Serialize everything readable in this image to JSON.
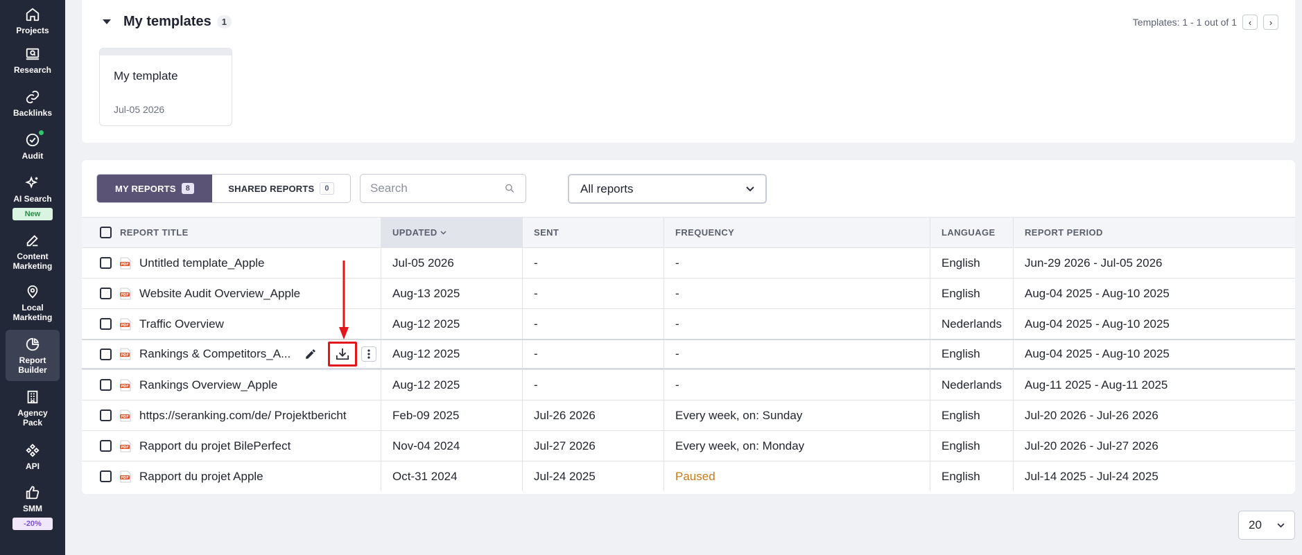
{
  "sidebar": {
    "items": [
      {
        "label": "Projects",
        "icon": "home-icon"
      },
      {
        "label": "Research",
        "icon": "research-icon"
      },
      {
        "label": "Backlinks",
        "icon": "link-icon"
      },
      {
        "label": "Audit",
        "icon": "check-circle-icon"
      },
      {
        "label": "AI Search",
        "icon": "sparkle-icon",
        "badge": "New"
      },
      {
        "label": "Content Marketing",
        "icon": "edit-icon"
      },
      {
        "label": "Local Marketing",
        "icon": "map-pin-icon"
      },
      {
        "label": "Report Builder",
        "icon": "pie-chart-icon",
        "active": true
      },
      {
        "label": "Agency Pack",
        "icon": "building-icon"
      },
      {
        "label": "API",
        "icon": "api-icon"
      },
      {
        "label": "SMM",
        "icon": "thumbs-up-icon",
        "badge": "-20%"
      }
    ]
  },
  "templates": {
    "title": "My templates",
    "count": "1",
    "pager_text": "Templates: 1 - 1 out of 1",
    "items": [
      {
        "name": "My template",
        "date": "Jul-05 2026"
      }
    ]
  },
  "reports": {
    "tabs": [
      {
        "label": "MY REPORTS",
        "count": "8"
      },
      {
        "label": "SHARED REPORTS",
        "count": "0"
      }
    ],
    "search_placeholder": "Search",
    "filter_value": "All reports",
    "columns": [
      "REPORT TITLE",
      "UPDATED",
      "SENT",
      "FREQUENCY",
      "LANGUAGE",
      "REPORT PERIOD"
    ],
    "rows": [
      {
        "title": "Untitled template_Apple",
        "updated": "Jul-05 2026",
        "sent": "-",
        "frequency": "-",
        "language": "English",
        "period": "Jun-29 2026 - Jul-05 2026"
      },
      {
        "title": "Website Audit Overview_Apple",
        "updated": "Aug-13 2025",
        "sent": "-",
        "frequency": "-",
        "language": "English",
        "period": "Aug-04 2025 - Aug-10 2025"
      },
      {
        "title": "Traffic Overview",
        "updated": "Aug-12 2025",
        "sent": "-",
        "frequency": "-",
        "language": "Nederlands",
        "period": "Aug-04 2025 - Aug-10 2025"
      },
      {
        "title": "Rankings & Competitors_A...",
        "updated": "Aug-12 2025",
        "sent": "-",
        "frequency": "-",
        "language": "English",
        "period": "Aug-04 2025 - Aug-10 2025"
      },
      {
        "title": "Rankings Overview_Apple",
        "updated": "Aug-12 2025",
        "sent": "-",
        "frequency": "-",
        "language": "Nederlands",
        "period": "Aug-11 2025 - Aug-11 2025"
      },
      {
        "title": "https://seranking.com/de/ Projektbericht",
        "updated": "Feb-09 2025",
        "sent": "Jul-26 2026",
        "frequency": "Every week, on: Sunday",
        "language": "English",
        "period": "Jul-20 2026 - Jul-26 2026"
      },
      {
        "title": "Rapport du projet BilePerfect",
        "updated": "Nov-04 2024",
        "sent": "Jul-27 2026",
        "frequency": "Every week, on: Monday",
        "language": "English",
        "period": "Jul-20 2026 - Jul-27 2026"
      },
      {
        "title": "Rapport du projet Apple",
        "updated": "Oct-31 2024",
        "sent": "Jul-24 2025",
        "frequency": "Paused",
        "language": "English",
        "period": "Jul-14 2025 - Jul-24 2025"
      }
    ]
  },
  "pagination": {
    "per_page": "20"
  },
  "colors": {
    "sidebar_bg": "#232838",
    "active_tab": "#5a5376",
    "highlight": "#e3161e",
    "paused": "#c47b1c"
  }
}
